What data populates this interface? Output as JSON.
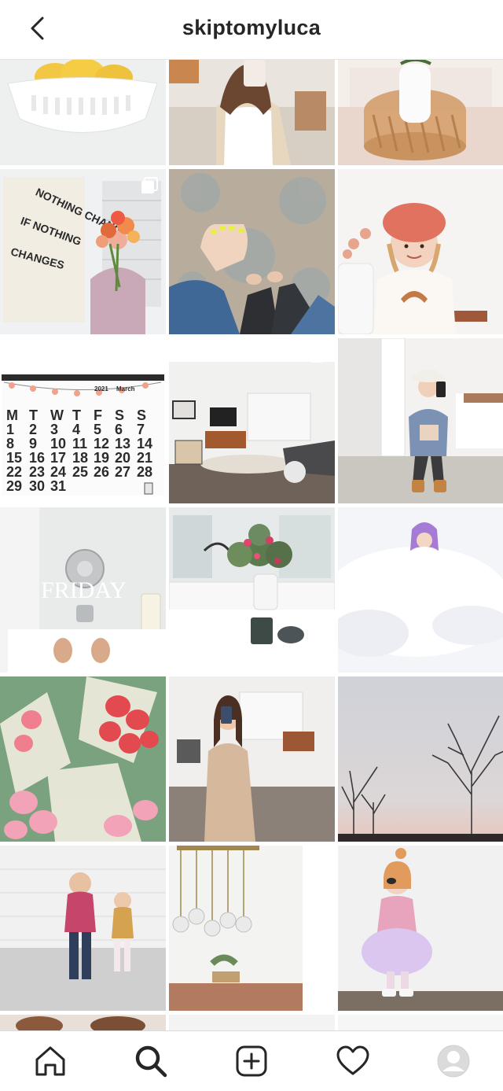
{
  "header": {
    "username": "skiptomyluca"
  },
  "grid": {
    "posts": [
      {
        "id": 1,
        "subject": "lemons in white bowl"
      },
      {
        "id": 2,
        "subject": "woman taking mirror selfie"
      },
      {
        "id": 3,
        "subject": "rattan tray with vase"
      },
      {
        "id": 4,
        "subject": "flowers and wall print",
        "print_text": [
          "NOTHING CHANGES",
          "IF NOTHING",
          "CHANGES"
        ]
      },
      {
        "id": 5,
        "subject": "hand over rug"
      },
      {
        "id": 6,
        "subject": "girl in pink beret"
      },
      {
        "id": 7,
        "subject": "wall calendar",
        "calendar": {
          "year": "2021",
          "month": "March",
          "weekdays": [
            "M",
            "T",
            "W",
            "T",
            "F",
            "S",
            "S"
          ],
          "weeks": [
            [
              "1",
              "2",
              "3",
              "4",
              "5",
              "6",
              "7"
            ],
            [
              "8",
              "9",
              "10",
              "11",
              "12",
              "13",
              "14"
            ],
            [
              "15",
              "16",
              "17",
              "18",
              "19",
              "20",
              "21"
            ],
            [
              "22",
              "23",
              "24",
              "25",
              "26",
              "27",
              "28"
            ],
            [
              "29",
              "30",
              "31",
              "",
              "",
              "",
              ""
            ]
          ]
        }
      },
      {
        "id": 8,
        "subject": "living room"
      },
      {
        "id": 9,
        "subject": "woman mirror selfie with hat"
      },
      {
        "id": 10,
        "subject": "bath time",
        "overlay_text": "FRIDAY"
      },
      {
        "id": 11,
        "subject": "kitchen flowers"
      },
      {
        "id": 12,
        "subject": "child in snow"
      },
      {
        "id": 13,
        "subject": "pink tulips"
      },
      {
        "id": 14,
        "subject": "woman in beige jumpsuit"
      },
      {
        "id": 15,
        "subject": "winter trees sky"
      },
      {
        "id": 16,
        "subject": "two kids walking"
      },
      {
        "id": 17,
        "subject": "dining pendant light"
      },
      {
        "id": 18,
        "subject": "girl in tutu"
      }
    ]
  },
  "nav": {
    "items": [
      "home-icon",
      "search-icon",
      "new-post-icon",
      "activity-icon",
      "profile-avatar"
    ],
    "active": "search-icon"
  }
}
